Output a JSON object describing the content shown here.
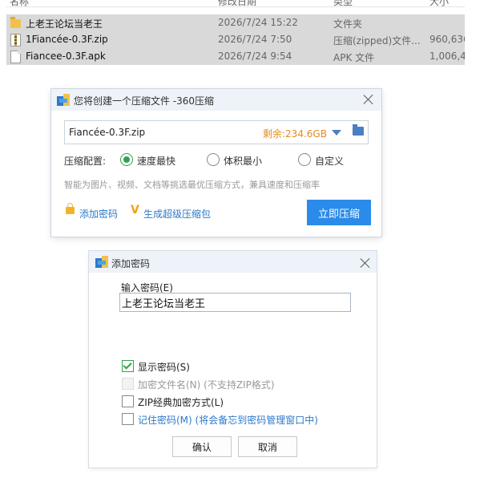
{
  "file_list": {
    "rows": [
      {
        "icon": "folder-icon",
        "name": "上老王论坛当老王",
        "date": "2026/7/24 15:22",
        "type": "文件夹",
        "size": ""
      },
      {
        "icon": "zip-file-icon",
        "name": "1Fiancée-0.3F.zip",
        "date": "2026/7/24 7:50",
        "type": "压缩(zipped)文件...",
        "size": "960,636"
      },
      {
        "icon": "apk-file-icon",
        "name": "Fiancee-0.3F.apk",
        "date": "2026/7/24 9:54",
        "type": "APK 文件",
        "size": "1,006,4"
      }
    ]
  },
  "compress_dialog": {
    "title": "您将创建一个压缩文件 -360压缩",
    "filename": "Fiancée-0.3F.zip",
    "free_space": "剩余:234.6GB",
    "config_label": "压缩配置:",
    "options": [
      {
        "label": "速度最快",
        "selected": true
      },
      {
        "label": "体积最小",
        "selected": false
      },
      {
        "label": "自定义",
        "selected": false
      }
    ],
    "hint": "智能为图片、视频、文档等挑选最优压缩方式，兼具速度和压缩率",
    "add_password_link": "添加密码",
    "super_pack_link": "生成超级压缩包",
    "compress_button": "立即压缩"
  },
  "password_dialog": {
    "title": "添加密码",
    "input_label": "输入密码(E)",
    "password_value": "上老王论坛当老王",
    "checkboxes": [
      {
        "label": "显示密码(S)",
        "checked": true,
        "disabled": false
      },
      {
        "label": "加密文件名(N) (不支持ZIP格式)",
        "checked": false,
        "disabled": true
      },
      {
        "label": "ZIP经典加密方式(L)",
        "checked": false,
        "disabled": false
      },
      {
        "label": "记住密码(M) (将会备忘到密码管理窗口中)",
        "checked": false,
        "disabled": false
      }
    ],
    "ok_button": "确认",
    "cancel_button": "取消"
  }
}
